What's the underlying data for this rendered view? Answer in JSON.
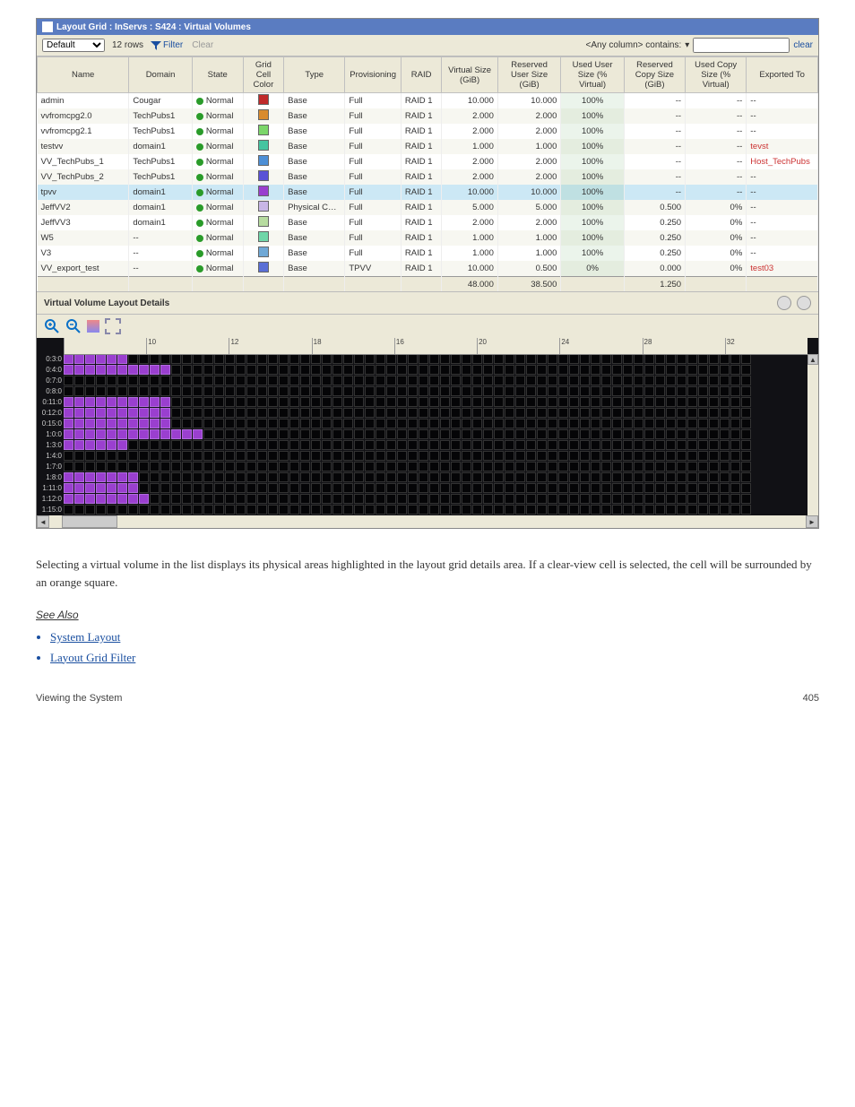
{
  "window": {
    "title": "Layout Grid : InServs : S424 : Virtual Volumes"
  },
  "toolbar": {
    "view_select": "Default",
    "rows_label": "12 rows",
    "filter_label": "Filter",
    "clear_label": "Clear",
    "filter_column_label": "<Any column> contains:",
    "filter_input_value": "",
    "right_clear_label": "clear"
  },
  "columns": [
    "Name",
    "Domain",
    "State",
    "Grid Cell Color",
    "Type",
    "Provisioning",
    "RAID",
    "Virtual Size (GiB)",
    "Reserved User Size (GiB)",
    "Used User Size (% Virtual)",
    "Reserved Copy Size (GiB)",
    "Used Copy Size (% Virtual)",
    "Exported To"
  ],
  "rows": [
    {
      "name": "admin",
      "domain": "Cougar",
      "state": "Normal",
      "color": "#c02a2a",
      "type": "Base",
      "prov": "Full",
      "raid": "RAID 1",
      "vsize": "10.000",
      "rsize": "10.000",
      "uuser": "100%",
      "rcopy": "--",
      "ucopy": "--",
      "exported": "--"
    },
    {
      "name": "vvfromcpg2.0",
      "domain": "TechPubs1",
      "state": "Normal",
      "color": "#d98b2e",
      "type": "Base",
      "prov": "Full",
      "raid": "RAID 1",
      "vsize": "2.000",
      "rsize": "2.000",
      "uuser": "100%",
      "rcopy": "--",
      "ucopy": "--",
      "exported": "--"
    },
    {
      "name": "vvfromcpg2.1",
      "domain": "TechPubs1",
      "state": "Normal",
      "color": "#7bd66a",
      "type": "Base",
      "prov": "Full",
      "raid": "RAID 1",
      "vsize": "2.000",
      "rsize": "2.000",
      "uuser": "100%",
      "rcopy": "--",
      "ucopy": "--",
      "exported": "--"
    },
    {
      "name": "testvv",
      "domain": "domain1",
      "state": "Normal",
      "color": "#45c4a0",
      "type": "Base",
      "prov": "Full",
      "raid": "RAID 1",
      "vsize": "1.000",
      "rsize": "1.000",
      "uuser": "100%",
      "rcopy": "--",
      "ucopy": "--",
      "exported": "tevst"
    },
    {
      "name": "VV_TechPubs_1",
      "domain": "TechPubs1",
      "state": "Normal",
      "color": "#4d8fd6",
      "type": "Base",
      "prov": "Full",
      "raid": "RAID 1",
      "vsize": "2.000",
      "rsize": "2.000",
      "uuser": "100%",
      "rcopy": "--",
      "ucopy": "--",
      "exported": "Host_TechPubs"
    },
    {
      "name": "VV_TechPubs_2",
      "domain": "TechPubs1",
      "state": "Normal",
      "color": "#5a52d6",
      "type": "Base",
      "prov": "Full",
      "raid": "RAID 1",
      "vsize": "2.000",
      "rsize": "2.000",
      "uuser": "100%",
      "rcopy": "--",
      "ucopy": "--",
      "exported": "--"
    },
    {
      "name": "tpvv",
      "domain": "domain1",
      "state": "Normal",
      "color": "#9a3fcf",
      "type": "Base",
      "prov": "Full",
      "raid": "RAID 1",
      "vsize": "10.000",
      "rsize": "10.000",
      "uuser": "100%",
      "rcopy": "--",
      "ucopy": "--",
      "exported": "--",
      "selected": true
    },
    {
      "name": "JeffVV2",
      "domain": "domain1",
      "state": "Normal",
      "color": "#c8b6e6",
      "type": "Physical Copy",
      "prov": "Full",
      "raid": "RAID 1",
      "vsize": "5.000",
      "rsize": "5.000",
      "uuser": "100%",
      "rcopy": "0.500",
      "ucopy": "0%",
      "exported": "--"
    },
    {
      "name": "JeffVV3",
      "domain": "domain1",
      "state": "Normal",
      "color": "#b7dca0",
      "type": "Base",
      "prov": "Full",
      "raid": "RAID 1",
      "vsize": "2.000",
      "rsize": "2.000",
      "uuser": "100%",
      "rcopy": "0.250",
      "ucopy": "0%",
      "exported": "--"
    },
    {
      "name": "W5",
      "domain": "--",
      "state": "Normal",
      "color": "#6fd6a8",
      "type": "Base",
      "prov": "Full",
      "raid": "RAID 1",
      "vsize": "1.000",
      "rsize": "1.000",
      "uuser": "100%",
      "rcopy": "0.250",
      "ucopy": "0%",
      "exported": "--"
    },
    {
      "name": "V3",
      "domain": "--",
      "state": "Normal",
      "color": "#6fa8d6",
      "type": "Base",
      "prov": "Full",
      "raid": "RAID 1",
      "vsize": "1.000",
      "rsize": "1.000",
      "uuser": "100%",
      "rcopy": "0.250",
      "ucopy": "0%",
      "exported": "--"
    },
    {
      "name": "VV_export_test",
      "domain": "--",
      "state": "Normal",
      "color": "#5a6fd6",
      "type": "Base",
      "prov": "TPVV",
      "raid": "RAID 1",
      "vsize": "10.000",
      "rsize": "0.500",
      "uuser": "0%",
      "rcopy": "0.000",
      "ucopy": "0%",
      "exported": "test03"
    }
  ],
  "totals": {
    "vsize": "48.000",
    "rsize": "38.500",
    "rcopy": "1.250"
  },
  "details": {
    "title": "Virtual Volume Layout Details",
    "ruler_ticks": [
      "",
      "10",
      "12",
      "18",
      "16",
      "20",
      "24",
      "28",
      "32"
    ],
    "row_labels": [
      "0:3:0",
      "0:4:0",
      "0:7:0",
      "0:8:0",
      "0:11:0",
      "0:12:0",
      "0:15:0",
      "1:0:0",
      "1:3:0",
      "1:4:0",
      "1:7:0",
      "1:8:0",
      "1:11:0",
      "1:12:0",
      "1:15:0"
    ],
    "filled": {
      "0": 6,
      "1": 10,
      "2": 0,
      "3": 0,
      "4": 10,
      "5": 10,
      "6": 10,
      "7": 13,
      "8": 6,
      "9": 0,
      "10": 0,
      "11": 7,
      "12": 7,
      "13": 8,
      "14": 0
    }
  },
  "doc": {
    "p1": "Selecting a virtual volume in the list displays its physical areas highlighted in the layout grid details area. If a clear-view cell is selected, the cell will be surrounded by an orange square.",
    "subhead": "See Also",
    "link1": "System Layout",
    "link2": "Layout Grid Filter"
  },
  "footer": {
    "left": "Viewing the System",
    "right": "405"
  }
}
